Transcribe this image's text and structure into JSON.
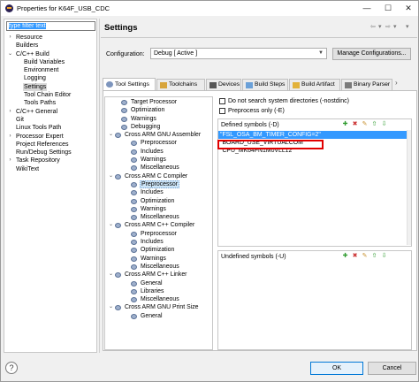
{
  "window": {
    "title": "Properties for K64F_USB_CDC",
    "controls": {
      "minimize": "—",
      "maximize": "☐",
      "close": "✕"
    }
  },
  "left": {
    "filter_text": "type filter text",
    "tree": [
      {
        "label": "Resource",
        "level": 0,
        "twisty": "›"
      },
      {
        "label": "Builders",
        "level": 0,
        "twisty": ""
      },
      {
        "label": "C/C++ Build",
        "level": 0,
        "twisty": "⌄"
      },
      {
        "label": "Build Variables",
        "level": 1,
        "twisty": ""
      },
      {
        "label": "Environment",
        "level": 1,
        "twisty": ""
      },
      {
        "label": "Logging",
        "level": 1,
        "twisty": ""
      },
      {
        "label": "Settings",
        "level": 1,
        "twisty": "",
        "selected": true
      },
      {
        "label": "Tool Chain Editor",
        "level": 1,
        "twisty": ""
      },
      {
        "label": "Tools Paths",
        "level": 1,
        "twisty": ""
      },
      {
        "label": "C/C++ General",
        "level": 0,
        "twisty": "›"
      },
      {
        "label": "Git",
        "level": 0,
        "twisty": ""
      },
      {
        "label": "Linux Tools Path",
        "level": 0,
        "twisty": ""
      },
      {
        "label": "Processor Expert",
        "level": 0,
        "twisty": "›"
      },
      {
        "label": "Project References",
        "level": 0,
        "twisty": ""
      },
      {
        "label": "Run/Debug Settings",
        "level": 0,
        "twisty": ""
      },
      {
        "label": "Task Repository",
        "level": 0,
        "twisty": "›"
      },
      {
        "label": "WikiText",
        "level": 0,
        "twisty": ""
      }
    ]
  },
  "settings": {
    "title": "Settings",
    "nav": {
      "back": "⇦",
      "back_menu": "▾",
      "forward": "⇨",
      "forward_menu": "▾",
      "menu": "▾"
    },
    "configuration_label": "Configuration:",
    "configuration_value": "Debug  [ Active ]",
    "manage_button": "Manage Configurations...",
    "tabs": [
      {
        "label": "Tool Settings",
        "active": true
      },
      {
        "label": "Toolchains"
      },
      {
        "label": "Devices"
      },
      {
        "label": "Build Steps"
      },
      {
        "label": "Build Artifact"
      },
      {
        "label": "Binary Parser"
      }
    ],
    "tab_scroll": "›",
    "tool_tree": [
      {
        "label": "Target Processor",
        "level": 1,
        "twisty": "",
        "icon": "gear"
      },
      {
        "label": "Optimization",
        "level": 1,
        "twisty": "",
        "icon": "gear"
      },
      {
        "label": "Warnings",
        "level": 1,
        "twisty": "",
        "icon": "gear"
      },
      {
        "label": "Debugging",
        "level": 1,
        "twisty": "",
        "icon": "gear"
      },
      {
        "label": "Cross ARM GNU Assembler",
        "level": 0,
        "twisty": "⌄",
        "icon": "gear"
      },
      {
        "label": "Preprocessor",
        "level": 2,
        "twisty": "",
        "icon": "gear"
      },
      {
        "label": "Includes",
        "level": 2,
        "twisty": "",
        "icon": "gear"
      },
      {
        "label": "Warnings",
        "level": 2,
        "twisty": "",
        "icon": "gear"
      },
      {
        "label": "Miscellaneous",
        "level": 2,
        "twisty": "",
        "icon": "gear"
      },
      {
        "label": "Cross ARM C Compiler",
        "level": 0,
        "twisty": "⌄",
        "icon": "gear"
      },
      {
        "label": "Preprocessor",
        "level": 2,
        "twisty": "",
        "icon": "gear",
        "selected": true
      },
      {
        "label": "Includes",
        "level": 2,
        "twisty": "",
        "icon": "gear"
      },
      {
        "label": "Optimization",
        "level": 2,
        "twisty": "",
        "icon": "gear"
      },
      {
        "label": "Warnings",
        "level": 2,
        "twisty": "",
        "icon": "gear"
      },
      {
        "label": "Miscellaneous",
        "level": 2,
        "twisty": "",
        "icon": "gear"
      },
      {
        "label": "Cross ARM C++ Compiler",
        "level": 0,
        "twisty": "⌄",
        "icon": "gear"
      },
      {
        "label": "Preprocessor",
        "level": 2,
        "twisty": "",
        "icon": "gear"
      },
      {
        "label": "Includes",
        "level": 2,
        "twisty": "",
        "icon": "gear"
      },
      {
        "label": "Optimization",
        "level": 2,
        "twisty": "",
        "icon": "gear"
      },
      {
        "label": "Warnings",
        "level": 2,
        "twisty": "",
        "icon": "gear"
      },
      {
        "label": "Miscellaneous",
        "level": 2,
        "twisty": "",
        "icon": "gear"
      },
      {
        "label": "Cross ARM C++ Linker",
        "level": 0,
        "twisty": "⌄",
        "icon": "gear"
      },
      {
        "label": "General",
        "level": 2,
        "twisty": "",
        "icon": "gear"
      },
      {
        "label": "Libraries",
        "level": 2,
        "twisty": "",
        "icon": "gear"
      },
      {
        "label": "Miscellaneous",
        "level": 2,
        "twisty": "",
        "icon": "gear"
      },
      {
        "label": "Cross ARM GNU Print Size",
        "level": 0,
        "twisty": "⌄",
        "icon": "gear"
      },
      {
        "label": "General",
        "level": 2,
        "twisty": "",
        "icon": "gear"
      }
    ],
    "option_nostdinc": "Do not search system directories (-nostdinc)",
    "option_preprocess_only": "Preprocess only (-E)",
    "defined_symbols_title": "Defined symbols (-D)",
    "defined_symbols": [
      "\"FSL_OSA_BM_TIMER_CONFIG=2\"",
      "\"BOARD_USE_VIRTUALCOM\"",
      "\"CPU_MK64FN1M0VLL12\""
    ],
    "undefined_symbols_title": "Undefined symbols (-U)",
    "list_tools": [
      "✚",
      "✖",
      "✎",
      "⇧",
      "⇩"
    ]
  },
  "buttons": {
    "help": "?",
    "ok": "OK",
    "cancel": "Cancel"
  },
  "colors": {
    "selection": "#3399ff",
    "highlight_box": "#e10000"
  }
}
